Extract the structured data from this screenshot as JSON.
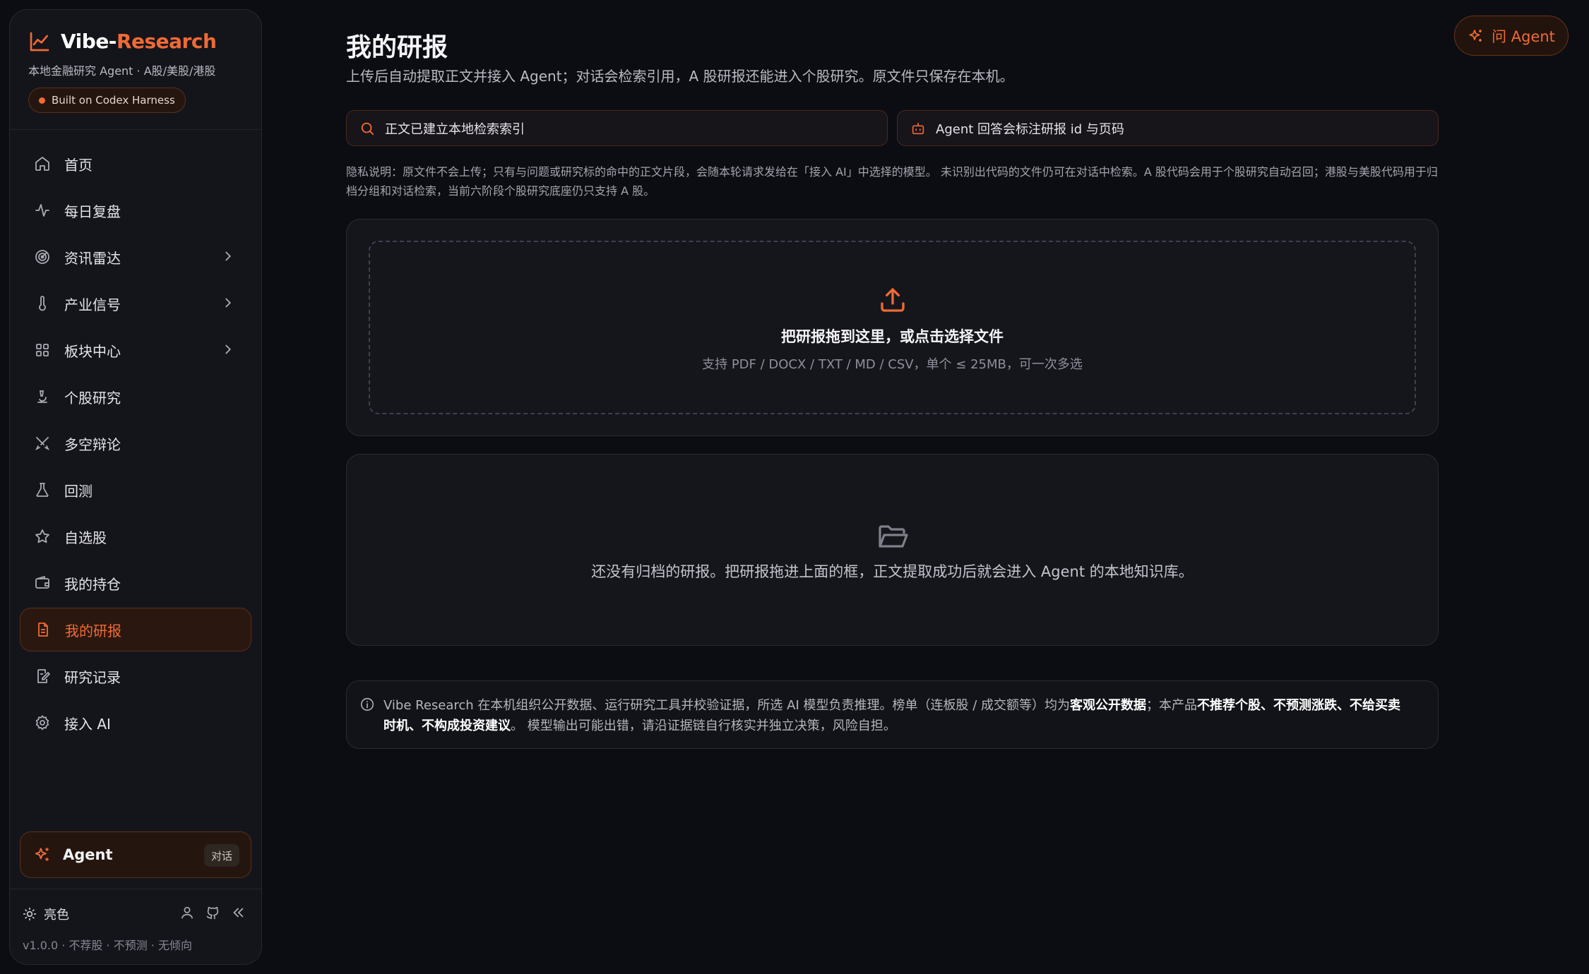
{
  "sidebar": {
    "brand": {
      "title_white": "Vibe-",
      "title_orange": "Research",
      "subtitle": "本地金融研究 Agent · A股/美股/港股",
      "harness": "Built on Codex Harness"
    },
    "items": [
      {
        "label": "首页"
      },
      {
        "label": "每日复盘"
      },
      {
        "label": "资讯雷达"
      },
      {
        "label": "产业信号"
      },
      {
        "label": "板块中心"
      },
      {
        "label": "个股研究"
      },
      {
        "label": "多空辩论"
      },
      {
        "label": "回测"
      },
      {
        "label": "自选股"
      },
      {
        "label": "我的持仓"
      },
      {
        "label": "我的研报"
      },
      {
        "label": "研究记录"
      },
      {
        "label": "接入 AI"
      }
    ],
    "agent": {
      "label": "Agent",
      "badge": "对话"
    },
    "theme_label": "亮色",
    "version": "v1.0.0 · 不荐股 · 不预测 · 无倾向"
  },
  "header": {
    "ask_agent": "问 Agent"
  },
  "main": {
    "title": "我的研报",
    "subtitle": "上传后自动提取正文并接入 Agent；对话会检索引用，A 股研报还能进入个股研究。原文件只保存在本机。",
    "pill_index": "正文已建立本地检索索引",
    "pill_cite": "Agent 回答会标注研报 id 与页码",
    "privacy": "隐私说明：原文件不会上传；只有与问题或研究标的命中的正文片段，会随本轮请求发给在「接入 AI」中选择的模型。 未识别出代码的文件仍可在对话中检索。A 股代码会用于个股研究自动召回；港股与美股代码用于归档分组和对话检索，当前六阶段个股研究底座仍只支持 A 股。",
    "drop_title": "把研报拖到这里，或点击选择文件",
    "drop_hint": "支持 PDF / DOCX / TXT / MD / CSV，单个 ≤ 25MB，可一次多选",
    "empty_text": "还没有归档的研报。把研报拖进上面的框，正文提取成功后就会进入 Agent 的本地知识库。",
    "disclaimer": {
      "p1": "Vibe Research 在本机组织公开数据、运行研究工具并校验证据，所选 AI 模型负责推理。榜单（连板股 / 成交额等）均为",
      "b1": "客观公开数据",
      "p2": "；本产品",
      "b2": "不推荐个股、不预测涨跌、不给买卖时机、不构成投资建议",
      "p3": "。 模型输出可能出错，请沿证据链自行核实并独立决策，风险自担。"
    }
  },
  "colors": {
    "accent": "#f06a35",
    "background": "#0c0d12",
    "panel": "#14151b"
  }
}
